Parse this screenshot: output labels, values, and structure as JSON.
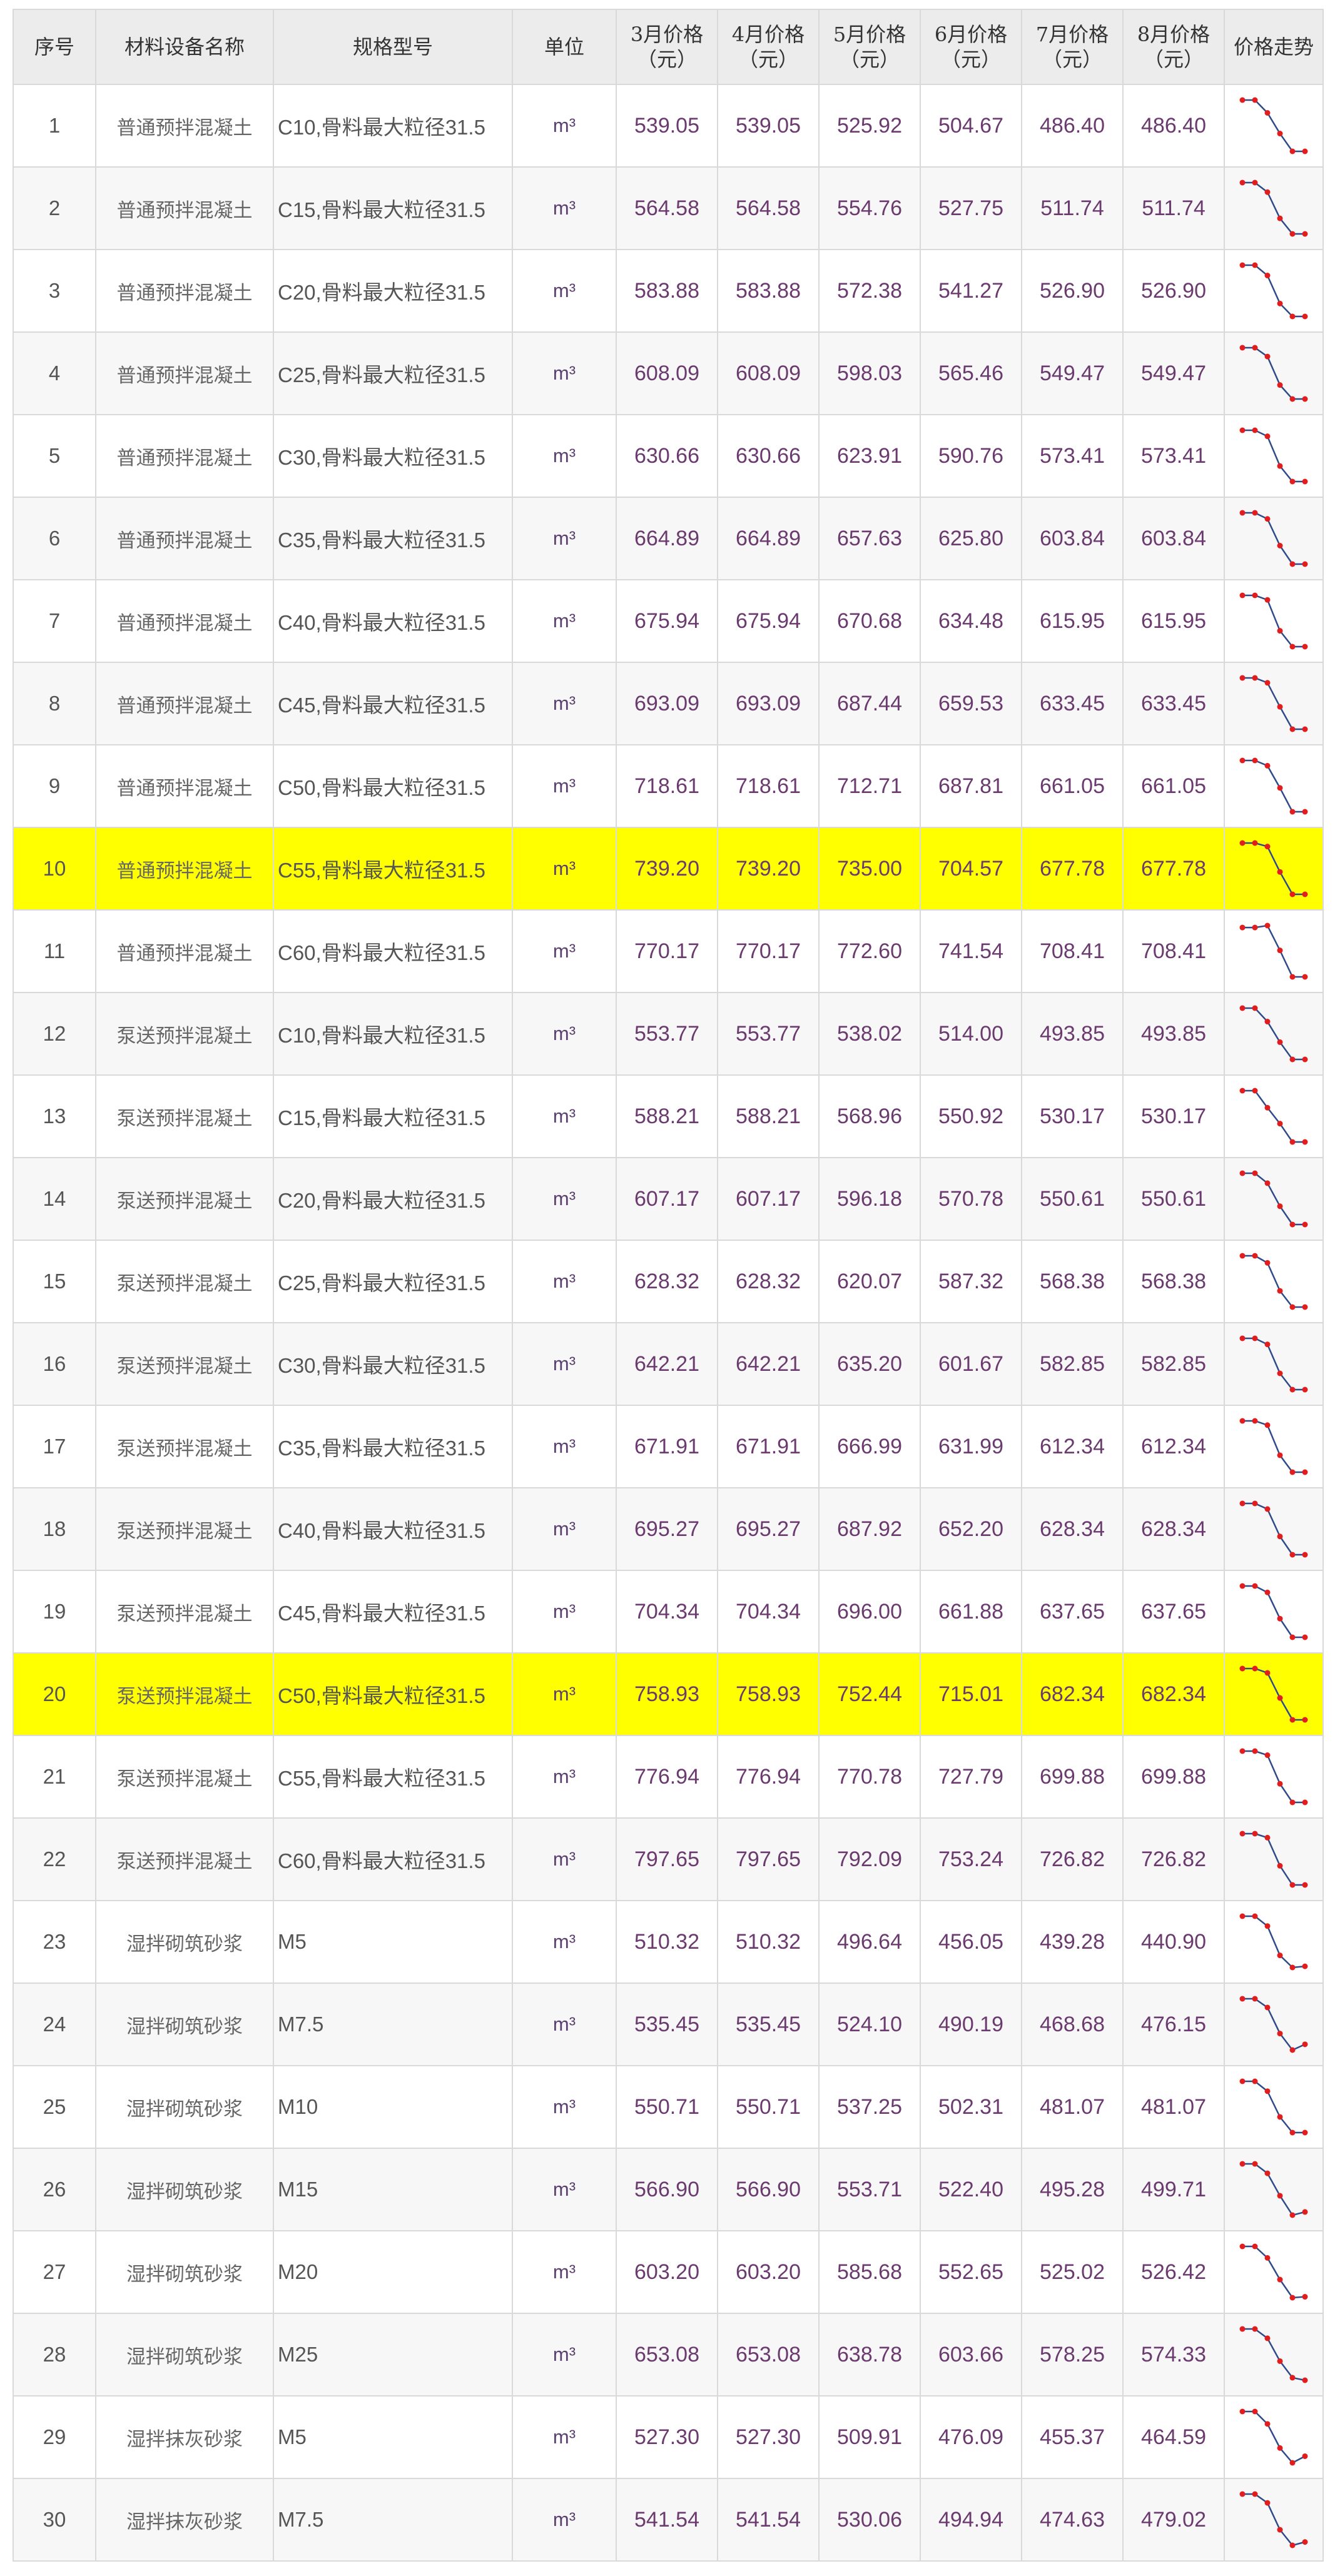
{
  "table": {
    "headers": [
      "序号",
      "材料设备名称",
      "规格型号",
      "单位",
      "3月价格\n（元）",
      "4月价格\n（元）",
      "5月价格\n（元）",
      "6月价格\n（元）",
      "7月价格\n（元）",
      "8月价格\n（元）",
      "价格走势"
    ],
    "highlight_rows": [
      10,
      20
    ],
    "highlight_color": "#ffff00",
    "sparkline": {
      "line_color": "#2f4a8a",
      "point_color": "#e01e1e"
    },
    "rows": [
      {
        "idx": "1",
        "name": "普通预拌混凝土",
        "spec": "C10,骨料最大粒径31.5",
        "unit": "m³",
        "prices": [
          "539.05",
          "539.05",
          "525.92",
          "504.67",
          "486.40",
          "486.40"
        ]
      },
      {
        "idx": "2",
        "name": "普通预拌混凝土",
        "spec": "C15,骨料最大粒径31.5",
        "unit": "m³",
        "prices": [
          "564.58",
          "564.58",
          "554.76",
          "527.75",
          "511.74",
          "511.74"
        ]
      },
      {
        "idx": "3",
        "name": "普通预拌混凝土",
        "spec": "C20,骨料最大粒径31.5",
        "unit": "m³",
        "prices": [
          "583.88",
          "583.88",
          "572.38",
          "541.27",
          "526.90",
          "526.90"
        ]
      },
      {
        "idx": "4",
        "name": "普通预拌混凝土",
        "spec": "C25,骨料最大粒径31.5",
        "unit": "m³",
        "prices": [
          "608.09",
          "608.09",
          "598.03",
          "565.46",
          "549.47",
          "549.47"
        ]
      },
      {
        "idx": "5",
        "name": "普通预拌混凝土",
        "spec": "C30,骨料最大粒径31.5",
        "unit": "m³",
        "prices": [
          "630.66",
          "630.66",
          "623.91",
          "590.76",
          "573.41",
          "573.41"
        ]
      },
      {
        "idx": "6",
        "name": "普通预拌混凝土",
        "spec": "C35,骨料最大粒径31.5",
        "unit": "m³",
        "prices": [
          "664.89",
          "664.89",
          "657.63",
          "625.80",
          "603.84",
          "603.84"
        ]
      },
      {
        "idx": "7",
        "name": "普通预拌混凝土",
        "spec": "C40,骨料最大粒径31.5",
        "unit": "m³",
        "prices": [
          "675.94",
          "675.94",
          "670.68",
          "634.48",
          "615.95",
          "615.95"
        ]
      },
      {
        "idx": "8",
        "name": "普通预拌混凝土",
        "spec": "C45,骨料最大粒径31.5",
        "unit": "m³",
        "prices": [
          "693.09",
          "693.09",
          "687.44",
          "659.53",
          "633.45",
          "633.45"
        ]
      },
      {
        "idx": "9",
        "name": "普通预拌混凝土",
        "spec": "C50,骨料最大粒径31.5",
        "unit": "m³",
        "prices": [
          "718.61",
          "718.61",
          "712.71",
          "687.81",
          "661.05",
          "661.05"
        ]
      },
      {
        "idx": "10",
        "name": "普通预拌混凝土",
        "spec": "C55,骨料最大粒径31.5",
        "unit": "m³",
        "prices": [
          "739.20",
          "739.20",
          "735.00",
          "704.57",
          "677.78",
          "677.78"
        ]
      },
      {
        "idx": "11",
        "name": "普通预拌混凝土",
        "spec": "C60,骨料最大粒径31.5",
        "unit": "m³",
        "prices": [
          "770.17",
          "770.17",
          "772.60",
          "741.54",
          "708.41",
          "708.41"
        ]
      },
      {
        "idx": "12",
        "name": "泵送预拌混凝土",
        "spec": "C10,骨料最大粒径31.5",
        "unit": "m³",
        "prices": [
          "553.77",
          "553.77",
          "538.02",
          "514.00",
          "493.85",
          "493.85"
        ]
      },
      {
        "idx": "13",
        "name": "泵送预拌混凝土",
        "spec": "C15,骨料最大粒径31.5",
        "unit": "m³",
        "prices": [
          "588.21",
          "588.21",
          "568.96",
          "550.92",
          "530.17",
          "530.17"
        ]
      },
      {
        "idx": "14",
        "name": "泵送预拌混凝土",
        "spec": "C20,骨料最大粒径31.5",
        "unit": "m³",
        "prices": [
          "607.17",
          "607.17",
          "596.18",
          "570.78",
          "550.61",
          "550.61"
        ]
      },
      {
        "idx": "15",
        "name": "泵送预拌混凝土",
        "spec": "C25,骨料最大粒径31.5",
        "unit": "m³",
        "prices": [
          "628.32",
          "628.32",
          "620.07",
          "587.32",
          "568.38",
          "568.38"
        ]
      },
      {
        "idx": "16",
        "name": "泵送预拌混凝土",
        "spec": "C30,骨料最大粒径31.5",
        "unit": "m³",
        "prices": [
          "642.21",
          "642.21",
          "635.20",
          "601.67",
          "582.85",
          "582.85"
        ]
      },
      {
        "idx": "17",
        "name": "泵送预拌混凝土",
        "spec": "C35,骨料最大粒径31.5",
        "unit": "m³",
        "prices": [
          "671.91",
          "671.91",
          "666.99",
          "631.99",
          "612.34",
          "612.34"
        ]
      },
      {
        "idx": "18",
        "name": "泵送预拌混凝土",
        "spec": "C40,骨料最大粒径31.5",
        "unit": "m³",
        "prices": [
          "695.27",
          "695.27",
          "687.92",
          "652.20",
          "628.34",
          "628.34"
        ]
      },
      {
        "idx": "19",
        "name": "泵送预拌混凝土",
        "spec": "C45,骨料最大粒径31.5",
        "unit": "m³",
        "prices": [
          "704.34",
          "704.34",
          "696.00",
          "661.88",
          "637.65",
          "637.65"
        ]
      },
      {
        "idx": "20",
        "name": "泵送预拌混凝土",
        "spec": "C50,骨料最大粒径31.5",
        "unit": "m³",
        "prices": [
          "758.93",
          "758.93",
          "752.44",
          "715.01",
          "682.34",
          "682.34"
        ]
      },
      {
        "idx": "21",
        "name": "泵送预拌混凝土",
        "spec": "C55,骨料最大粒径31.5",
        "unit": "m³",
        "prices": [
          "776.94",
          "776.94",
          "770.78",
          "727.79",
          "699.88",
          "699.88"
        ]
      },
      {
        "idx": "22",
        "name": "泵送预拌混凝土",
        "spec": "C60,骨料最大粒径31.5",
        "unit": "m³",
        "prices": [
          "797.65",
          "797.65",
          "792.09",
          "753.24",
          "726.82",
          "726.82"
        ]
      },
      {
        "idx": "23",
        "name": "湿拌砌筑砂浆",
        "spec": "M5",
        "unit": "m³",
        "prices": [
          "510.32",
          "510.32",
          "496.64",
          "456.05",
          "439.28",
          "440.90"
        ]
      },
      {
        "idx": "24",
        "name": "湿拌砌筑砂浆",
        "spec": "M7.5",
        "unit": "m³",
        "prices": [
          "535.45",
          "535.45",
          "524.10",
          "490.19",
          "468.68",
          "476.15"
        ]
      },
      {
        "idx": "25",
        "name": "湿拌砌筑砂浆",
        "spec": "M10",
        "unit": "m³",
        "prices": [
          "550.71",
          "550.71",
          "537.25",
          "502.31",
          "481.07",
          "481.07"
        ]
      },
      {
        "idx": "26",
        "name": "湿拌砌筑砂浆",
        "spec": "M15",
        "unit": "m³",
        "prices": [
          "566.90",
          "566.90",
          "553.71",
          "522.40",
          "495.28",
          "499.71"
        ]
      },
      {
        "idx": "27",
        "name": "湿拌砌筑砂浆",
        "spec": "M20",
        "unit": "m³",
        "prices": [
          "603.20",
          "603.20",
          "585.68",
          "552.65",
          "525.02",
          "526.42"
        ]
      },
      {
        "idx": "28",
        "name": "湿拌砌筑砂浆",
        "spec": "M25",
        "unit": "m³",
        "prices": [
          "653.08",
          "653.08",
          "638.78",
          "603.66",
          "578.25",
          "574.33"
        ]
      },
      {
        "idx": "29",
        "name": "湿拌抹灰砂浆",
        "spec": "M5",
        "unit": "m³",
        "prices": [
          "527.30",
          "527.30",
          "509.91",
          "476.09",
          "455.37",
          "464.59"
        ]
      },
      {
        "idx": "30",
        "name": "湿拌抹灰砂浆",
        "spec": "M7.5",
        "unit": "m³",
        "prices": [
          "541.54",
          "541.54",
          "530.06",
          "494.94",
          "474.63",
          "479.02"
        ]
      }
    ]
  }
}
